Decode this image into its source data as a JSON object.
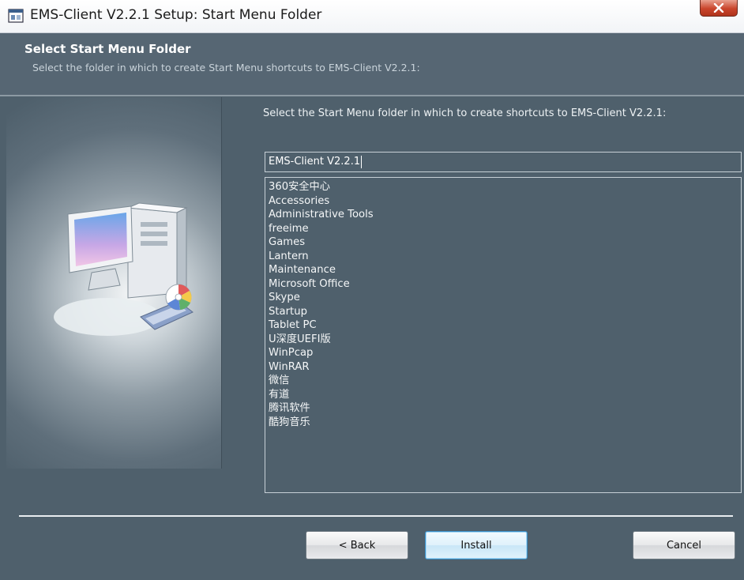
{
  "window": {
    "title": "EMS-Client V2.2.1 Setup: Start Menu Folder",
    "close_label": "X"
  },
  "header": {
    "title": "Select Start Menu Folder",
    "subtitle": "Select the folder in which to create Start Menu shortcuts to EMS-Client V2.2.1:"
  },
  "main": {
    "instruction": "Select the Start Menu folder in which to create shortcuts to EMS-Client V2.2.1:",
    "folder_input_value": "EMS-Client V2.2.1",
    "folders": [
      "360安全中心",
      "Accessories",
      "Administrative Tools",
      "freeime",
      "Games",
      "Lantern",
      "Maintenance",
      "Microsoft Office",
      "Skype",
      "Startup",
      "Tablet PC",
      "U深度UEFI版",
      "WinPcap",
      "WinRAR",
      "微信",
      "有道",
      "腾讯软件",
      "酷狗音乐"
    ]
  },
  "buttons": {
    "back": "< Back",
    "install": "Install",
    "cancel": "Cancel"
  },
  "colors": {
    "background": "#4f606c",
    "header": "#566673",
    "close_button": "#c9452c"
  }
}
